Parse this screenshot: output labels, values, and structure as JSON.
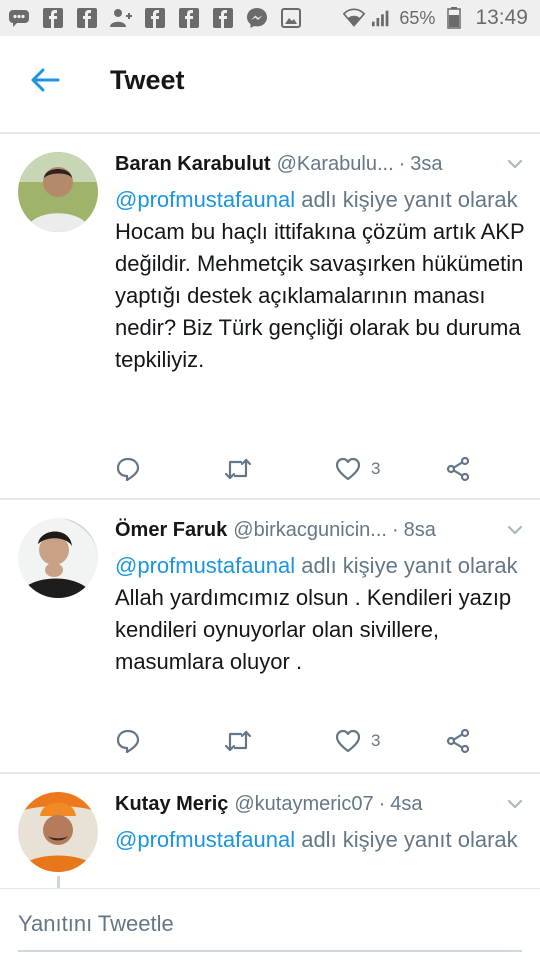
{
  "status_bar": {
    "icons": [
      "messages-icon",
      "facebook-icon",
      "facebook-icon",
      "add-friend-icon",
      "facebook-icon",
      "facebook-icon",
      "facebook-icon",
      "messenger-icon",
      "gallery-icon",
      "wifi-icon",
      "signal-icon"
    ],
    "battery": "65%",
    "time": "13:49"
  },
  "header": {
    "title": "Tweet"
  },
  "tweets": [
    {
      "name": "Baran Karabulut",
      "handle": "@Karabulu...",
      "sep": "·",
      "time": "3sa",
      "mention": "@profmustafaunal",
      "reply_suffix": " adlı kişiye yanıt olarak",
      "text": "Hocam bu haçlı ittifakına çözüm artık AKP değildir. Mehmetçik savaşırken hükümetin yaptığı destek açıklamalarının manası nedir? Biz Türk gençliği olarak bu duruma tepkiliyiz.",
      "likes": "3"
    },
    {
      "name": "Ömer Faruk",
      "handle": "@birkacgunicin...",
      "sep": "·",
      "time": "8sa",
      "mention": "@profmustafaunal",
      "reply_suffix": " adlı kişiye yanıt olarak",
      "text": "Allah yardımcımız olsun . Kendileri yazıp kendileri oynuyorlar olan sivillere, masumlara oluyor .",
      "likes": "3"
    },
    {
      "name": "Kutay Meriç",
      "handle": "@kutaymeric07",
      "sep": "·",
      "time": "4sa",
      "mention": "@profmustafaunal",
      "reply_suffix": " adlı kişiye yanıt olarak"
    }
  ],
  "composer": {
    "placeholder": "Yanıtını Tweetle"
  },
  "colors": {
    "accent": "#1b95e0",
    "muted": "#657786",
    "divider": "#e1e8ed"
  }
}
